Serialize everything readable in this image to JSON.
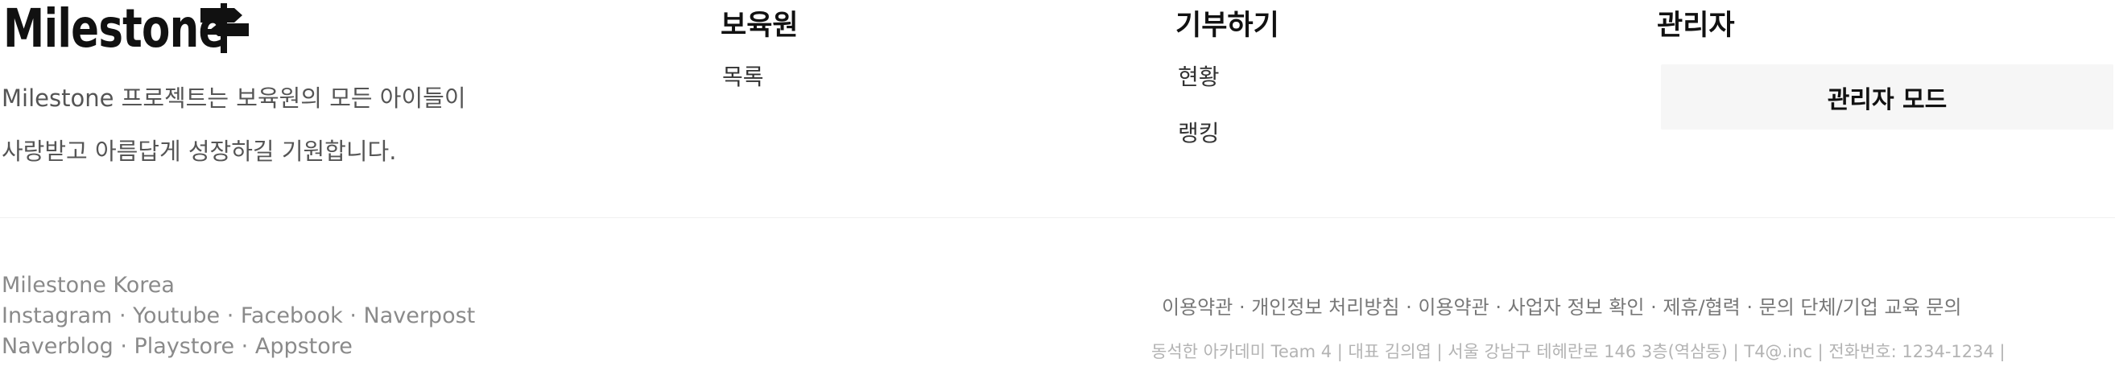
{
  "brand": {
    "logo_text": "Milestone",
    "description_line1": "Milestone 프로젝트는 보육원의 모든 아이들이",
    "description_line2": "사랑받고 아름답게 성장하길 기원합니다."
  },
  "nav": {
    "orphanage": {
      "title": "보육원",
      "links": [
        "목록"
      ]
    },
    "donate": {
      "title": "기부하기",
      "links": [
        "현황",
        "랭킹"
      ]
    },
    "admin": {
      "title": "관리자",
      "button_label": "관리자 모드"
    }
  },
  "footer": {
    "company_name": "Milestone Korea",
    "social_row1": [
      "Instagram",
      "Youtube",
      "Facebook",
      "Naverpost"
    ],
    "social_row2": [
      "Naverblog",
      "Playstore",
      "Appstore"
    ],
    "separator": " · ",
    "policies": [
      "이용약관",
      "개인정보 처리방침",
      "이용약관",
      "사업자 정보 확인",
      "제휴/협력",
      "문의 단체/기업 교육 문의"
    ],
    "company_info": "동석한 아카데미 Team 4 | 대표 김의엽 | 서울 강남구 테헤란로 146 3층(역삼동) | T4@.inc | 전화번호: 1234-1234 |"
  },
  "colors": {
    "admin_button_bg": "#f6f6f6",
    "footer_text": "#8a8a8a",
    "divider": "#f0f0f0"
  },
  "icons": {
    "logo_icon": "signpost-icon"
  }
}
